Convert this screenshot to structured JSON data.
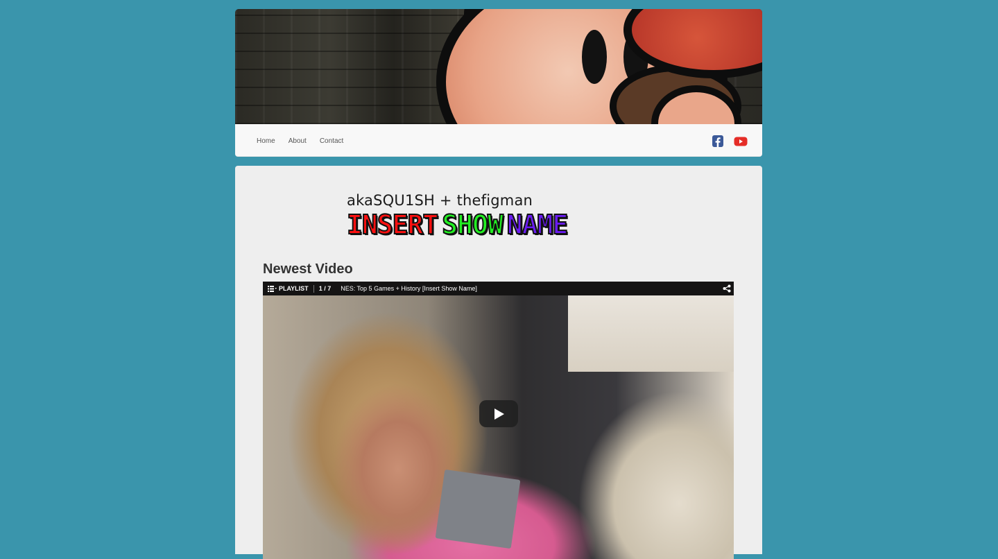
{
  "nav": {
    "links": [
      "Home",
      "About",
      "Contact"
    ],
    "social": [
      {
        "icon": "facebook-icon",
        "color": "#3b5998"
      },
      {
        "icon": "youtube-icon",
        "color": "#e52d27"
      }
    ]
  },
  "logo": {
    "subtitle": "akaSQU1SH + thefigman",
    "words": [
      {
        "text": "INSERT",
        "color": "#ff1010"
      },
      {
        "text": "SHOW",
        "color": "#22ee22"
      },
      {
        "text": "NAME",
        "color": "#6a1cf0"
      }
    ]
  },
  "section": {
    "title": "Newest Video"
  },
  "video": {
    "playlist_label": "PLAYLIST",
    "playlist_count": "1 / 7",
    "title": "NES: Top 5 Games + History [Insert Show Name]"
  },
  "colors": {
    "page_bg": "#3a95ac",
    "panel_bg": "#eeeeee",
    "nav_bg": "#f8f8f8"
  }
}
